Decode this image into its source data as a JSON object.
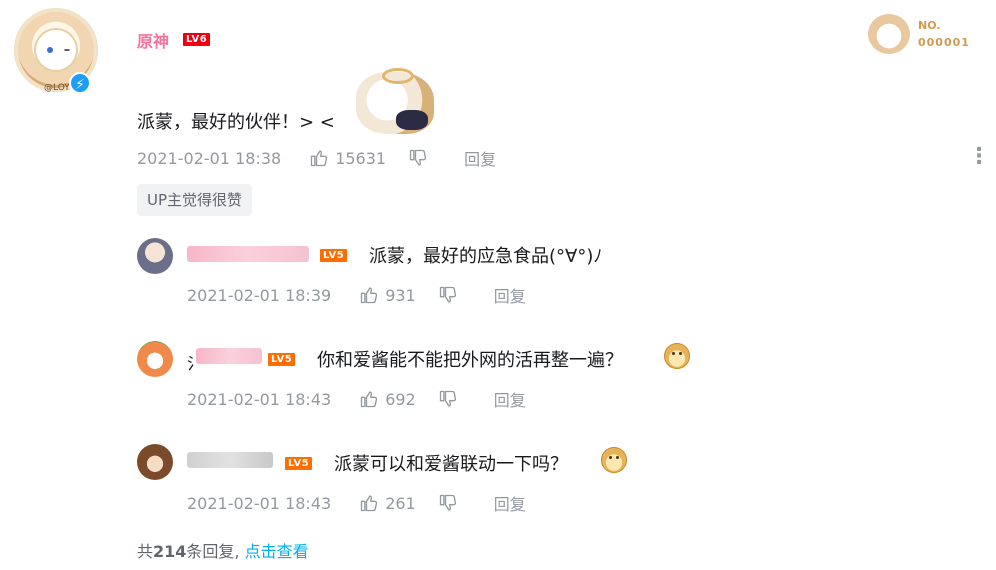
{
  "comment": {
    "user": {
      "name": "原神",
      "level": "LV6",
      "avatar_tag": "@LOY"
    },
    "fan_badge": {
      "no_label": "NO.",
      "number": "000001"
    },
    "text": "派蒙，最好的伙伴！> <",
    "time": "2021-02-01 18:38",
    "likes": "15631",
    "reply_label": "回复",
    "up_like_tag": "UP主觉得很赞",
    "more_icon": "more-vertical-icon"
  },
  "replies": [
    {
      "level": "LV5",
      "text": "派蒙，最好的应急食品(°∀°)ﾉ",
      "time": "2021-02-01 18:39",
      "likes": "931",
      "reply_label": "回复",
      "name_prefix": ""
    },
    {
      "level": "LV5",
      "text": "你和爱酱能不能把外网的活再整一遍？",
      "time": "2021-02-01 18:43",
      "likes": "692",
      "reply_label": "回复",
      "name_prefix": "氵"
    },
    {
      "level": "LV5",
      "text": "派蒙可以和爱酱联动一下吗？",
      "time": "2021-02-01 18:43",
      "likes": "261",
      "reply_label": "回复",
      "name_prefix": ""
    }
  ],
  "footer": {
    "prefix": "共",
    "count": "214",
    "suffix": "条回复,",
    "link": "点击查看"
  },
  "colors": {
    "name_pink": "#fb7299",
    "lv6": "#f0000f",
    "lv5": "#ff6c00",
    "link": "#00aeec",
    "meta": "#9499a0"
  }
}
